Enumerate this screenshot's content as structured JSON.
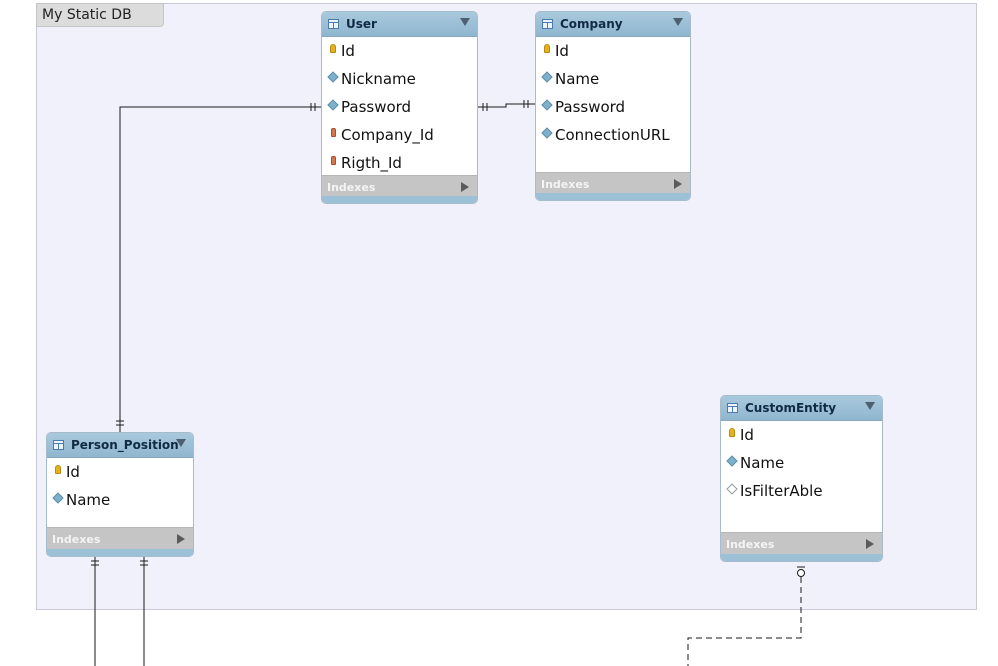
{
  "layer": {
    "title": "My Static DB"
  },
  "index_label": "Indexes",
  "colors": {
    "layer_bg": "#f0f1fb",
    "header": "#9bbfd6",
    "pk_key": "#e6b21f",
    "fk_key": "#d4774b",
    "connector": "#1a1a1a"
  },
  "tables": {
    "user": {
      "name": "User",
      "columns": [
        "Id",
        "Nickname",
        "Password",
        "Company_Id",
        "Rigth_Id"
      ]
    },
    "company": {
      "name": "Company",
      "columns": [
        "Id",
        "Name",
        "Password",
        "ConnectionURL"
      ]
    },
    "person_position": {
      "name": "Person_Position",
      "columns": [
        "Id",
        "Name"
      ]
    },
    "custom_entity": {
      "name": "CustomEntity",
      "columns": [
        "Id",
        "Name",
        "IsFilterAble"
      ]
    }
  }
}
